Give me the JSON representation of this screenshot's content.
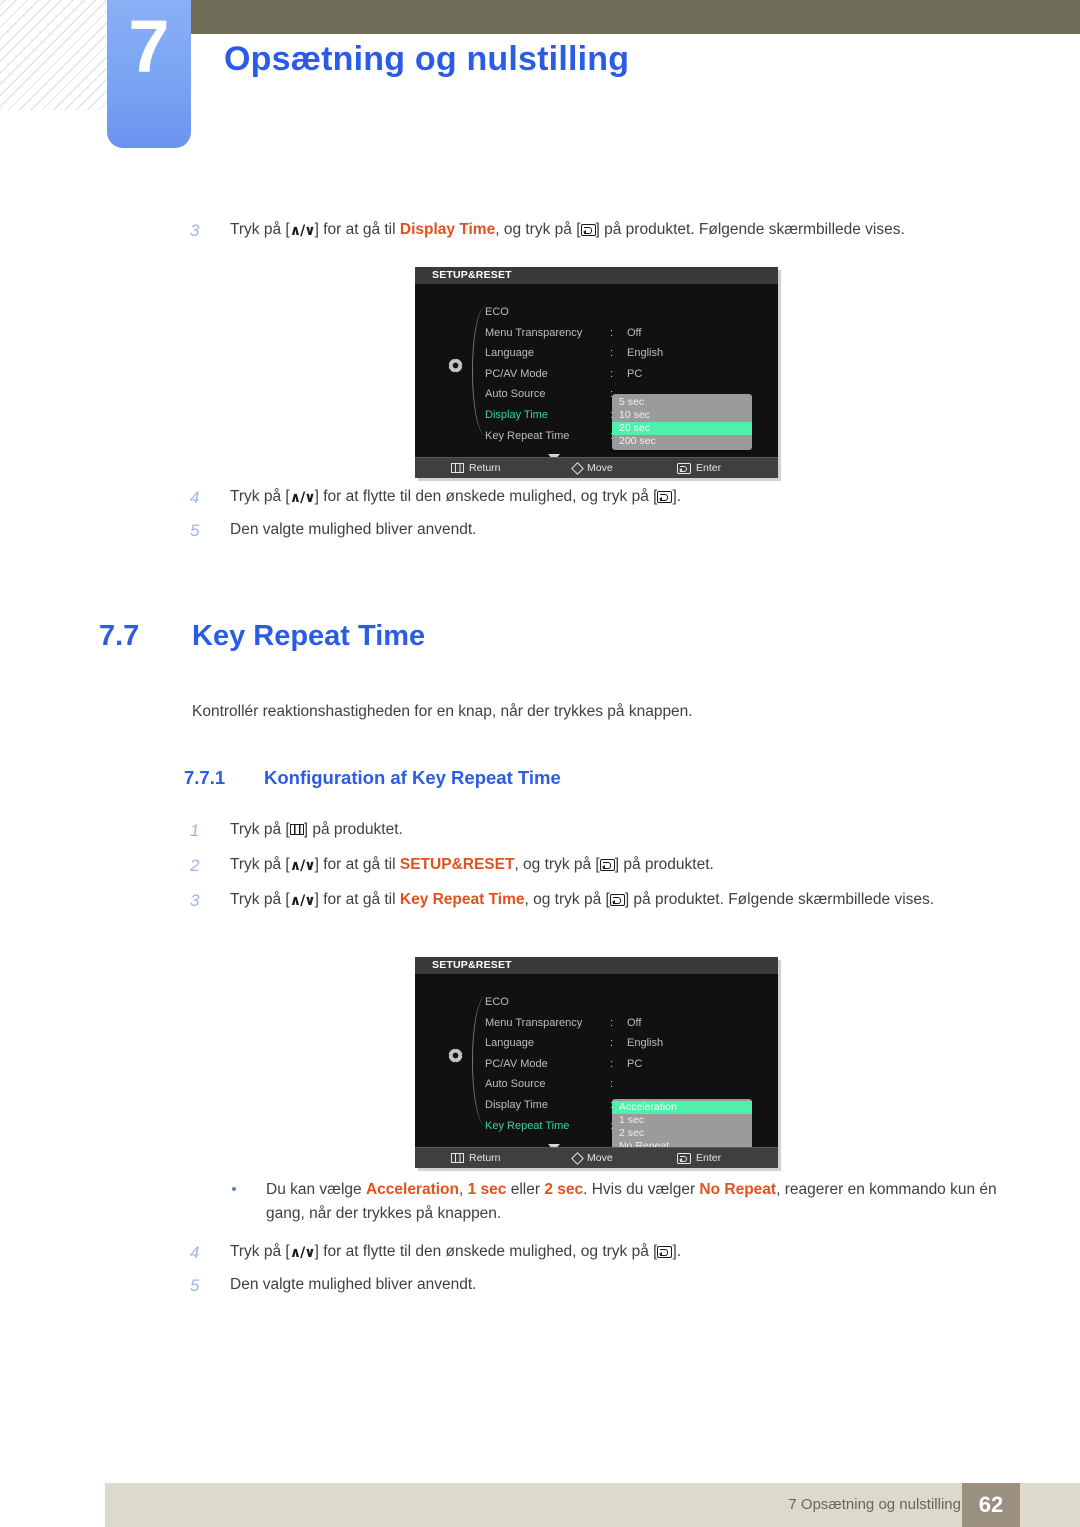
{
  "header": {
    "chapter_number": "7",
    "chapter_title": "Opsætning og nulstilling"
  },
  "section_a": {
    "step3": {
      "num": "3",
      "text_1": "Tryk på [",
      "key_updown": "∧/∨",
      "text_2": "] for at gå til ",
      "keyword": "Display Time",
      "text_3": ", og tryk på [",
      "text_4": "] på produktet. Følgende skærmbillede vises."
    },
    "step4": {
      "num": "4",
      "text_1": "Tryk på [",
      "key_updown": "∧/∨",
      "text_2": "] for at flytte til den ønskede mulighed, og tryk på [",
      "text_3": "]."
    },
    "step5": {
      "num": "5",
      "text": "Den valgte mulighed bliver anvendt."
    }
  },
  "heading_77": {
    "number": "7.7",
    "title": "Key Repeat Time"
  },
  "lead_77": "Kontrollér reaktionshastigheden for en knap, når der trykkes på knappen.",
  "heading_771": {
    "number": "7.7.1",
    "title": "Konfiguration af Key Repeat Time"
  },
  "section_b": {
    "step1": {
      "num": "1",
      "text_1": "Tryk på [",
      "text_2": "] på produktet."
    },
    "step2": {
      "num": "2",
      "text_1": "Tryk på [",
      "key_updown": "∧/∨",
      "text_2": "] for at gå til ",
      "keyword": "SETUP&RESET",
      "text_3": ", og tryk på [",
      "text_4": "] på produktet."
    },
    "step3": {
      "num": "3",
      "text_1": "Tryk på [",
      "key_updown": "∧/∨",
      "text_2": "] for at gå til ",
      "keyword": "Key Repeat Time",
      "text_3": ", og tryk på [",
      "text_4": "] på produktet. Følgende skærmbillede vises."
    },
    "bullet": {
      "text_1": "Du kan vælge ",
      "kw_1": "Acceleration",
      "text_2": ", ",
      "kw_2": "1 sec",
      "text_3": " eller ",
      "kw_3": "2 sec",
      "text_4": ". Hvis du vælger ",
      "kw_4": "No Repeat",
      "text_5": ", reagerer en kommando kun én gang, når der trykkes på knappen."
    },
    "step4": {
      "num": "4",
      "text_1": "Tryk på [",
      "key_updown": "∧/∨",
      "text_2": "] for at flytte til den ønskede mulighed, og tryk på [",
      "text_3": "]."
    },
    "step5": {
      "num": "5",
      "text": "Den valgte mulighed bliver anvendt."
    }
  },
  "osd1": {
    "title": "SETUP&RESET",
    "rows": [
      {
        "label": "ECO",
        "colon": "",
        "value": "",
        "active": false
      },
      {
        "label": "Menu Transparency",
        "colon": ":",
        "value": "Off",
        "active": false
      },
      {
        "label": "Language",
        "colon": ":",
        "value": "English",
        "active": false
      },
      {
        "label": "PC/AV Mode",
        "colon": ":",
        "value": "PC",
        "active": false
      },
      {
        "label": "Auto Source",
        "colon": ":",
        "value": "",
        "active": false
      },
      {
        "label": "Display Time",
        "colon": ":",
        "value": "",
        "active": true
      },
      {
        "label": "Key Repeat Time",
        "colon": ":",
        "value": "",
        "active": false
      }
    ],
    "dropdown": {
      "items": [
        "5 sec",
        "10 sec",
        "20 sec",
        "200 sec"
      ],
      "selected": "20 sec"
    },
    "footer": {
      "return": "Return",
      "move": "Move",
      "enter": "Enter"
    }
  },
  "osd2": {
    "title": "SETUP&RESET",
    "rows": [
      {
        "label": "ECO",
        "colon": "",
        "value": "",
        "active": false
      },
      {
        "label": "Menu Transparency",
        "colon": ":",
        "value": "Off",
        "active": false
      },
      {
        "label": "Language",
        "colon": ":",
        "value": "English",
        "active": false
      },
      {
        "label": "PC/AV Mode",
        "colon": ":",
        "value": "PC",
        "active": false
      },
      {
        "label": "Auto Source",
        "colon": ":",
        "value": "",
        "active": false
      },
      {
        "label": "Display Time",
        "colon": ":",
        "value": "",
        "active": false
      },
      {
        "label": "Key Repeat Time",
        "colon": ":",
        "value": "",
        "active": true
      }
    ],
    "dropdown": {
      "items": [
        "Acceleration",
        "1 sec",
        "2 sec",
        "No Repeat"
      ],
      "selected": "Acceleration"
    },
    "footer": {
      "return": "Return",
      "move": "Move",
      "enter": "Enter"
    }
  },
  "footer": {
    "text": "7 Opsætning og nulstilling",
    "page": "62"
  },
  "colors": {
    "accent_blue": "#2b5ce6",
    "keyword_orange": "#e4511e",
    "olive": "#6e6b56",
    "osd_green": "#35d69a",
    "osd_highlight": "#4ef0ac",
    "footer_bar": "#dedacb",
    "footer_page": "#9a8f80"
  }
}
